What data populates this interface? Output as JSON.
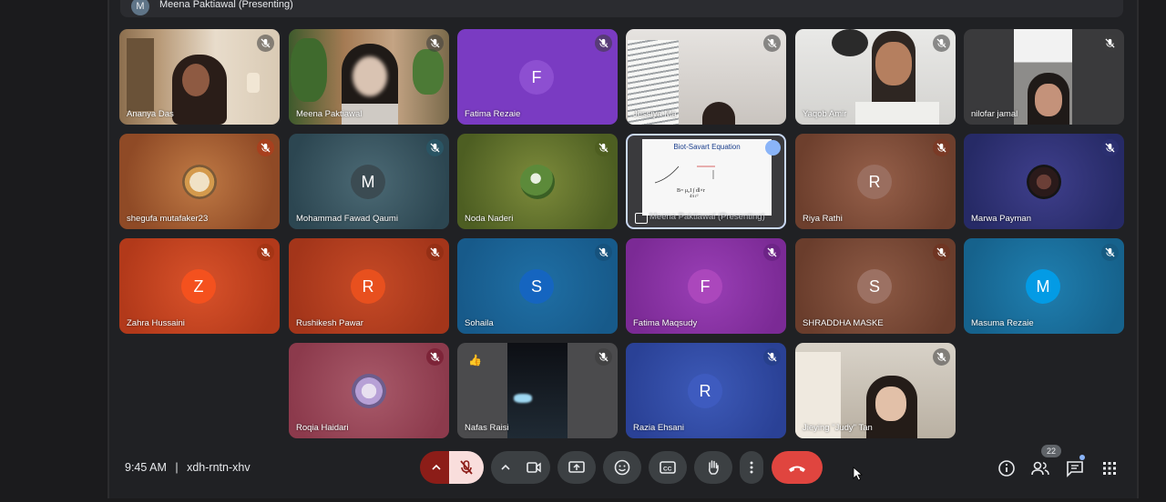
{
  "topbar": {
    "avatar_letter": "M",
    "presenting_label": "Meena Paktiawal (Presenting)"
  },
  "tiles": [
    {
      "name": "Ananya Das"
    },
    {
      "name": "Meena Paktiawal"
    },
    {
      "name": "Fatima Rezaie",
      "letter": "F"
    },
    {
      "name": "Jessiya Ma"
    },
    {
      "name": "Yaqob Amir"
    },
    {
      "name": "nilofar jamal"
    },
    {
      "name": "shegufa mutafaker23"
    },
    {
      "name": "Mohammad Fawad Qaumi",
      "letter": "M"
    },
    {
      "name": "Noda Naderi"
    },
    {
      "name": "Meena Paktiawal (Presenting)",
      "slide_title": "Biot-Savart Equation"
    },
    {
      "name": "Riya Rathi",
      "letter": "R"
    },
    {
      "name": "Marwa Payman"
    },
    {
      "name": "Zahra Hussaini",
      "letter": "Z"
    },
    {
      "name": "Rushikesh Pawar",
      "letter": "R"
    },
    {
      "name": "Sohaila",
      "letter": "S"
    },
    {
      "name": "Fatima Maqsudy",
      "letter": "F"
    },
    {
      "name": "SHRADDHA MASKE",
      "letter": "S"
    },
    {
      "name": "Masuma Rezaie",
      "letter": "M"
    },
    {
      "name": "Roqia Haidari"
    },
    {
      "name": "Nafas Raisi",
      "reaction": "👍"
    },
    {
      "name": "Razia Ehsani",
      "letter": "R"
    },
    {
      "name": "Jieying \"Judy\" Tan"
    }
  ],
  "meeting": {
    "time": "9:45 AM",
    "separator": "|",
    "code": "xdh-rntn-xhv"
  },
  "controls": {
    "people_count": "22"
  },
  "colors": {
    "hangup": "#e0453f",
    "mic_off": "#f9dedc",
    "accent_blue": "#8ab4f8"
  }
}
